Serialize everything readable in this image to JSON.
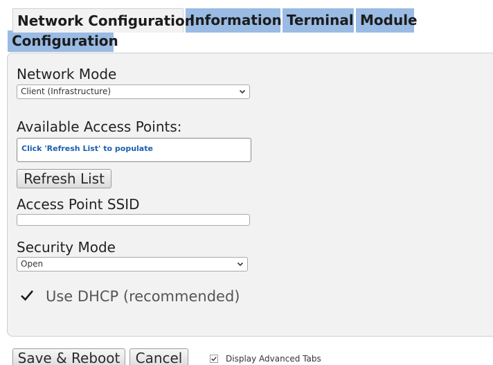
{
  "tabs": {
    "network_configuration": "Network Configuration",
    "information": "Information",
    "terminal": "Terminal",
    "module_configuration_line1": "Module",
    "module_configuration_line2": "Configuration"
  },
  "network_mode": {
    "label": "Network Mode",
    "selected": "Client (Infrastructure)"
  },
  "access_points": {
    "label": "Available Access Points:",
    "list_message": "Click 'Refresh List' to populate",
    "refresh_button": "Refresh List"
  },
  "ssid": {
    "label": "Access Point SSID",
    "value": ""
  },
  "security_mode": {
    "label": "Security Mode",
    "selected": "Open"
  },
  "dhcp": {
    "label": "Use DHCP (recommended)",
    "checked": true
  },
  "footer": {
    "save_button": "Save & Reboot",
    "cancel_button": "Cancel",
    "advanced_tabs_label": "Display Advanced Tabs",
    "advanced_tabs_checked": true
  },
  "icons": {
    "select_arrow": "chevron-down-icon",
    "checkbox_mark": "checkmark-icon"
  }
}
